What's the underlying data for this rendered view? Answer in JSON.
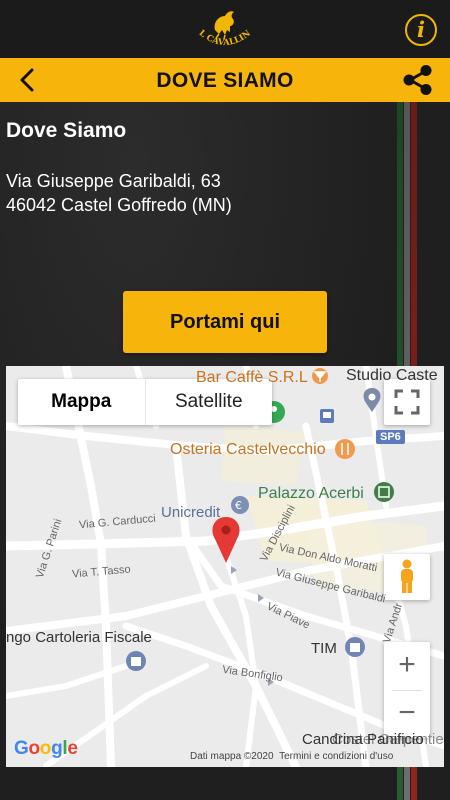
{
  "app": {
    "logo_text": "AL CAVALLINO"
  },
  "icons": {
    "info": "info-icon",
    "back": "back-arrow-icon",
    "share": "share-icon",
    "fullscreen": "fullscreen-icon",
    "pegman": "street-view-pegman-icon",
    "pin": "map-pin-icon"
  },
  "colors": {
    "accent": "#f7b50b",
    "topbar": "#1b1b1b",
    "background": "#1f1f1f"
  },
  "header": {
    "title": "DOVE SIAMO",
    "info_glyph": "i"
  },
  "content": {
    "heading": "Dove Siamo",
    "address_line1": "Via Giuseppe Garibaldi, 63",
    "address_line2": "46042 Castel Goffredo (MN)",
    "cta_label": "Portami qui"
  },
  "map": {
    "type_options": [
      "Mappa",
      "Satellite"
    ],
    "selected_type": "Mappa",
    "zoom_in": "+",
    "zoom_out": "−",
    "attribution_data": "Dati mappa ©2020",
    "attribution_terms": "Termini e condizioni d'uso",
    "logo": "Google",
    "pois": {
      "bar": "Bar Caffè S.R.L",
      "studio": "Studio Caste",
      "osteria": "Osteria Castelvecchio",
      "palazzo": "Palazzo Acerbi",
      "unicredit": "Unicredit",
      "cartoleria": "ngo Cartoleria Fiscale",
      "tim": "TIM",
      "candrina": "Candrina Panificio",
      "candrina_shadow": "Costel Carpentieri"
    },
    "streets": {
      "carducci": "Via G. Carducci",
      "parini": "Via G. Parini",
      "tasso": "Via T. Tasso",
      "disciplini": "Via Disciplini",
      "morattini": "Via Don Aldo Moratti",
      "garibaldi": "Via Giuseppe Garibaldi",
      "piave": "Via Piave",
      "bonfiglio": "Via Bonfiglio",
      "andr": "Via Andr"
    },
    "road_badge": "SP6"
  }
}
